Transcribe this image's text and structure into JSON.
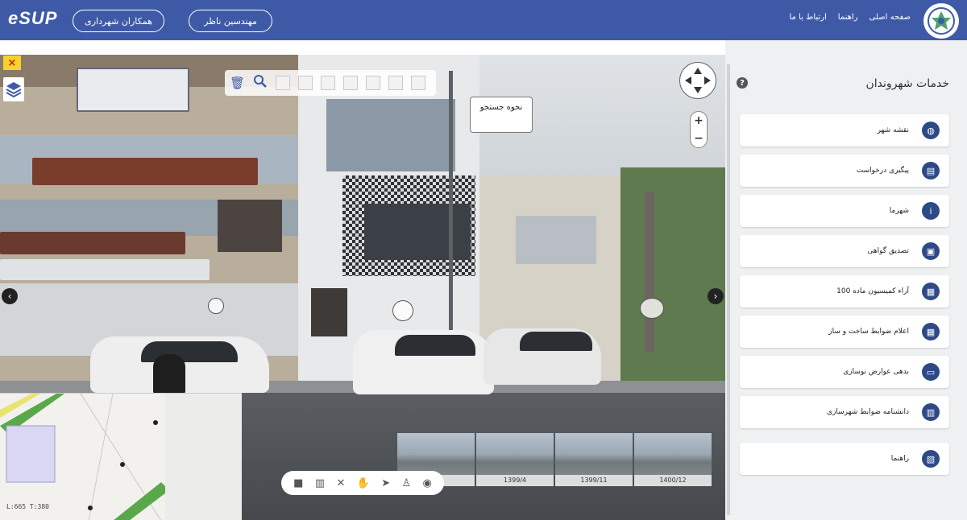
{
  "header": {
    "logo": "eSUP",
    "buttons": [
      "همکاران شهرداری",
      "مهندسین ناظر"
    ],
    "links": [
      "صفحه اصلی",
      "راهنما",
      "ارتباط با ما"
    ],
    "bg_color": "#3e5aa7"
  },
  "viewer": {
    "tooltip": "نحوه جستجو",
    "zoom_in": "+",
    "zoom_out": "−",
    "close": "×",
    "minimap_scale": "L:665 T:380",
    "thumbnails": [
      "",
      "1399/4",
      "1399/11",
      "1400/12"
    ],
    "bottom_tools": [
      "square-icon",
      "chart-icon",
      "cross-icon",
      "hand-icon",
      "cursor-icon",
      "person-icon",
      "camera-icon"
    ]
  },
  "panel": {
    "title": "خدمات شهروندان",
    "help": "?",
    "services": [
      {
        "label": "نقشه شهر",
        "icon": "globe-icon"
      },
      {
        "label": "پیگیری درخواست",
        "icon": "document-icon"
      },
      {
        "label": "شهرما",
        "icon": "info-icon"
      },
      {
        "label": "تصدیق گواهی",
        "icon": "certificate-icon"
      },
      {
        "label": "آراء کمیسیون ماده 100",
        "icon": "file-icon"
      },
      {
        "label": "اعلام ضوابط ساخت و ساز",
        "icon": "file-icon"
      },
      {
        "label": "بدهی عوارض نوسازی",
        "icon": "card-icon"
      },
      {
        "label": "دانشنامه ضوابط شهرسازی",
        "icon": "book-icon"
      },
      {
        "label": "راهنما",
        "icon": "guide-icon"
      }
    ]
  }
}
